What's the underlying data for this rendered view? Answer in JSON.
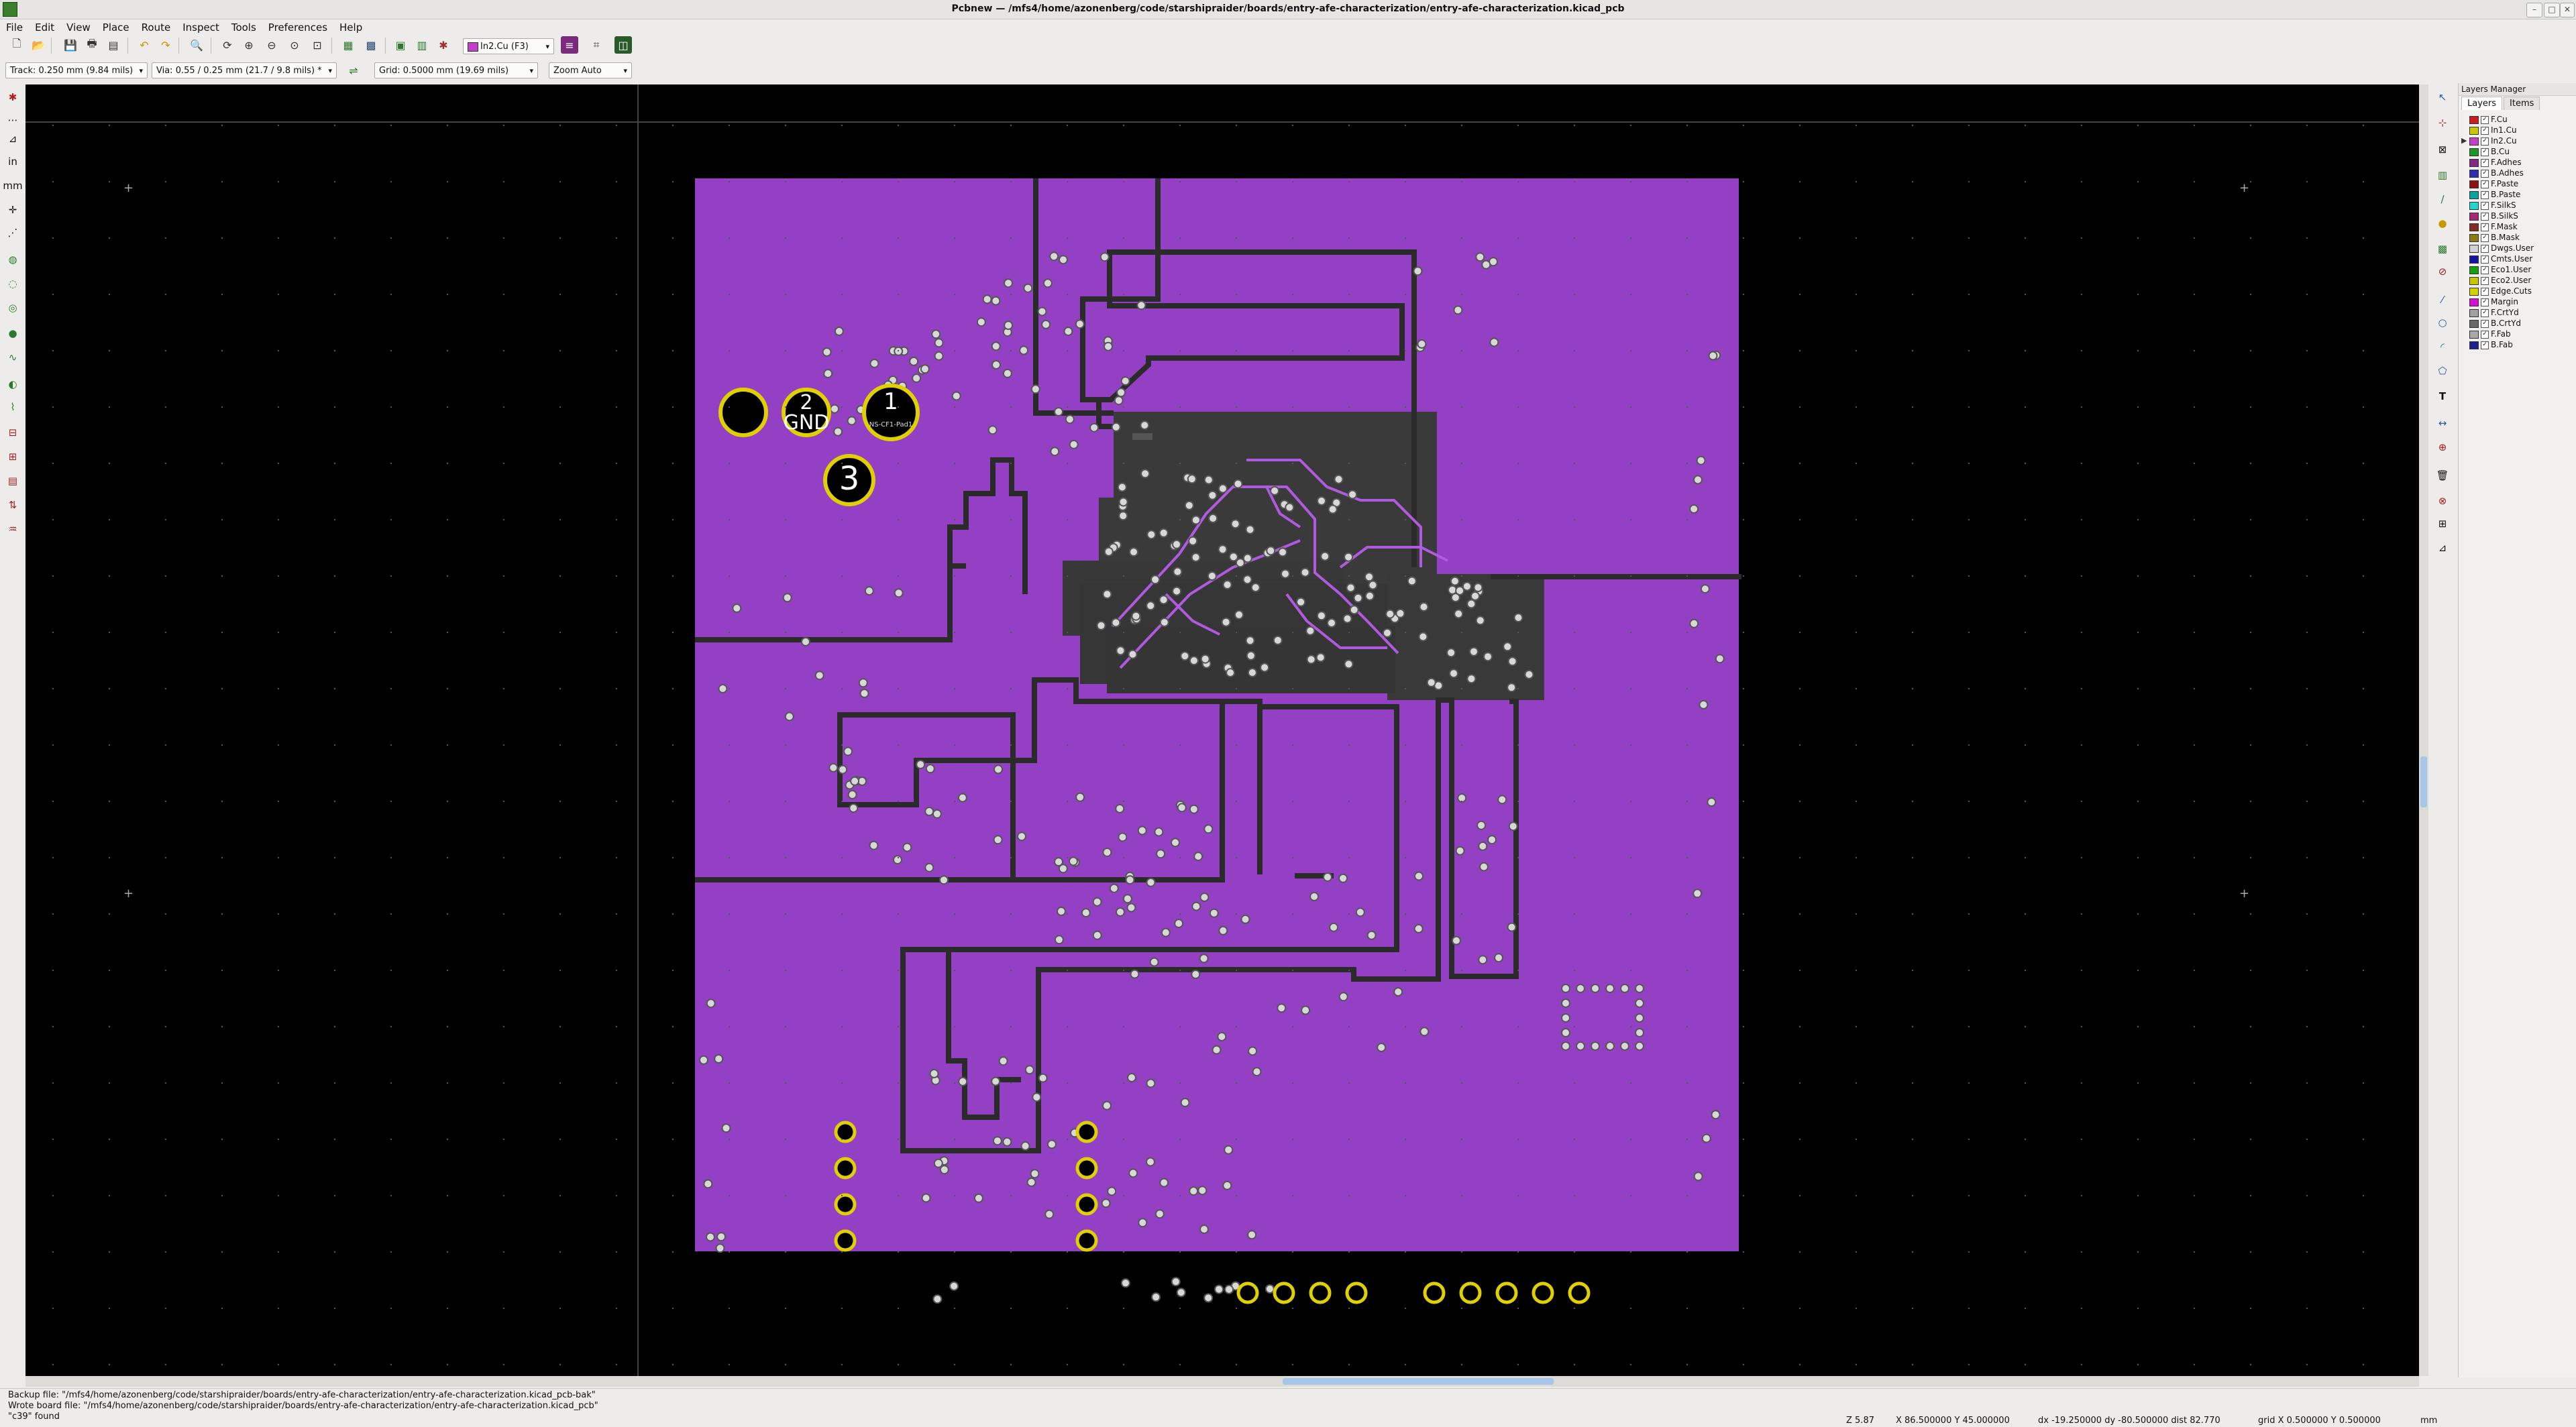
{
  "window": {
    "title": "Pcbnew — /mfs4/home/azonenberg/code/starshipraider/boards/entry-afe-characterization/entry-afe-characterization.kicad_pcb"
  },
  "menu": [
    "File",
    "Edit",
    "View",
    "Place",
    "Route",
    "Inspect",
    "Tools",
    "Preferences",
    "Help"
  ],
  "toolbar2": {
    "track": "Track: 0.250 mm (9.84 mils)",
    "via": "Via: 0.55 / 0.25 mm (21.7 / 9.8 mils) *",
    "grid": "Grid: 0.5000 mm (19.69 mils)",
    "zoom": "Zoom Auto"
  },
  "active_layer": "In2.Cu (F3)",
  "layers_manager": {
    "title": "Layers Manager",
    "tabs": [
      "Layers",
      "Items"
    ],
    "layers": [
      {
        "name": "F.Cu",
        "color": "#c81e1e"
      },
      {
        "name": "In1.Cu",
        "color": "#c8c800"
      },
      {
        "name": "In2.Cu",
        "color": "#c040c8",
        "active": true
      },
      {
        "name": "B.Cu",
        "color": "#1e9628"
      },
      {
        "name": "F.Adhes",
        "color": "#842888"
      },
      {
        "name": "B.Adhes",
        "color": "#2c2cb0"
      },
      {
        "name": "F.Paste",
        "color": "#8c1414"
      },
      {
        "name": "B.Paste",
        "color": "#08a0a0"
      },
      {
        "name": "F.SilkS",
        "color": "#28d2d2"
      },
      {
        "name": "B.SilkS",
        "color": "#a02878"
      },
      {
        "name": "F.Mask",
        "color": "#842828"
      },
      {
        "name": "B.Mask",
        "color": "#8c7a14"
      },
      {
        "name": "Dwgs.User",
        "color": "#d2d2d2"
      },
      {
        "name": "Cmts.User",
        "color": "#1414a0"
      },
      {
        "name": "Eco1.User",
        "color": "#14a014"
      },
      {
        "name": "Eco2.User",
        "color": "#c8c800"
      },
      {
        "name": "Edge.Cuts",
        "color": "#d2d200"
      },
      {
        "name": "Margin",
        "color": "#d214d2"
      },
      {
        "name": "F.CrtYd",
        "color": "#a0a0a0"
      },
      {
        "name": "B.CrtYd",
        "color": "#686868"
      },
      {
        "name": "F.Fab",
        "color": "#a8a8a8"
      },
      {
        "name": "B.Fab",
        "color": "#1e1e8c"
      }
    ]
  },
  "board": {
    "pads": [
      {
        "label": "",
        "sub": ""
      },
      {
        "label": "2",
        "sub": "GND"
      },
      {
        "label": "1",
        "sub": "NS-CF1-Pad1"
      },
      {
        "label": "3",
        "sub": ""
      }
    ]
  },
  "status": {
    "line1": "Backup file: \"/mfs4/home/azonenberg/code/starshipraider/boards/entry-afe-characterization/entry-afe-characterization.kicad_pcb-bak\"",
    "line2": "Wrote board file: \"/mfs4/home/azonenberg/code/starshipraider/boards/entry-afe-characterization/entry-afe-characterization.kicad_pcb\"",
    "line3": "\"c39\" found",
    "zoom": "Z 5.87",
    "xy": "X 86.500000  Y 45.000000",
    "dxy": "dx -19.250000  dy -80.500000  dist 82.770",
    "grid": "grid X 0.500000  Y 0.500000",
    "units": "mm"
  },
  "colors": {
    "copper_pour": "#9440c4",
    "pad_ring": "#e0d000",
    "background": "#000000"
  }
}
